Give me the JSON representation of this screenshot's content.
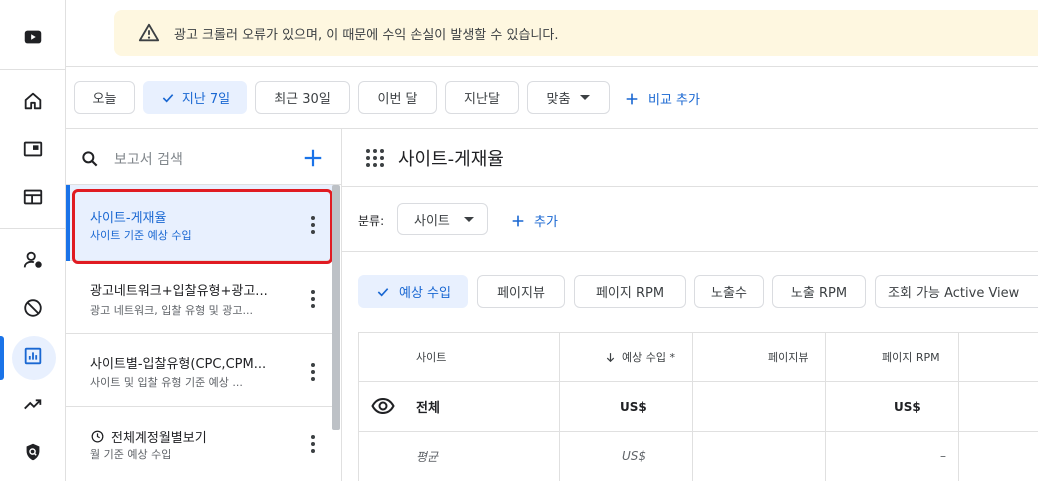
{
  "banner": {
    "icon": "warning-icon",
    "text": "광고 크롤러 오류가 있으며, 이 때문에 수익 손실이 발생할 수 있습니다."
  },
  "rail": {
    "items": [
      {
        "name": "youtube-icon"
      },
      {
        "name": "home-icon"
      },
      {
        "name": "ad-unit-icon"
      },
      {
        "name": "sites-icon"
      },
      {
        "name": "account-settings-icon"
      },
      {
        "name": "block-icon"
      },
      {
        "name": "reports-icon",
        "active": true
      },
      {
        "name": "trending-icon"
      },
      {
        "name": "privacy-shield-icon"
      }
    ],
    "accent": "#1a73e8"
  },
  "date_filters": {
    "items": [
      "오늘",
      "지난 7일",
      "최근 30일",
      "이번 달",
      "지난달",
      "맞춤"
    ],
    "selected": "지난 7일",
    "compare_label": "비교 추가"
  },
  "reports": {
    "search_placeholder": "보고서 검색",
    "items": [
      {
        "title": "사이트-게재율",
        "subtitle": "사이트 기준 예상 수입"
      },
      {
        "title": "광고네트워크+입찰유형+광고...",
        "subtitle": "광고 네트워크, 입찰 유형 및 광고..."
      },
      {
        "title": "사이트별-입찰유형(CPC,CPM...",
        "subtitle": "사이트 및 입찰 유형 기준 예상 ..."
      },
      {
        "title": "전체계정월별보기",
        "subtitle": "월 기준 예상 수입"
      }
    ]
  },
  "report_view": {
    "title": "사이트-게재율",
    "breakdown_label": "분류:",
    "breakdown_value": "사이트",
    "add_label": "추가",
    "metrics": [
      "예상 수입",
      "페이지뷰",
      "페이지 RPM",
      "노출수",
      "노출 RPM",
      "조회 가능 Active View"
    ],
    "selected_metric": "예상 수입",
    "table": {
      "headers": [
        "사이트",
        "예상 수입 *",
        "페이지뷰",
        "페이지 RPM"
      ],
      "rows": [
        {
          "label": "전체",
          "revenue": "US$",
          "pageviews": "",
          "rpm": "US$"
        },
        {
          "label": "평균",
          "revenue": "US$",
          "pageviews": "",
          "rpm": "–"
        }
      ]
    }
  },
  "colors": {
    "highlight": "#e01b22",
    "selected_bg": "#e8f0fe",
    "link": "#1967d2",
    "banner_bg": "#fef7e0"
  }
}
